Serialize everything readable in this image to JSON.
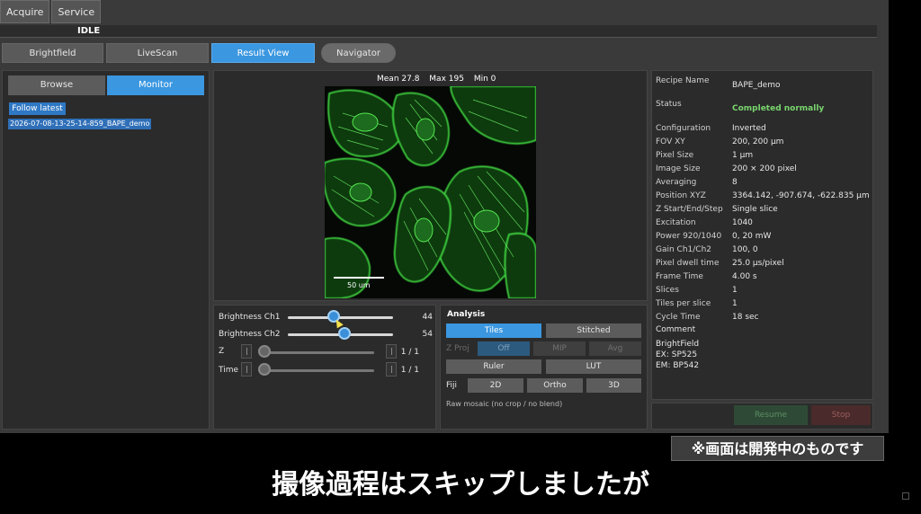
{
  "top_tabs": [
    "Acquire",
    "Service"
  ],
  "state_label": "IDLE",
  "mode_buttons": [
    "Brightfield",
    "LiveScan",
    "Result View",
    "Navigator"
  ],
  "left_panel": {
    "browse": "Browse",
    "monitor": "Monitor",
    "follow_latest": "Follow latest",
    "files": [
      "2026-07-08-13-25-14-859_BAPE_demo"
    ]
  },
  "image": {
    "mean": "Mean 27.8",
    "max": "Max 195",
    "min": "Min 0",
    "scale_label": "50 um"
  },
  "sliders": {
    "ch1": {
      "label": "Brightness Ch1",
      "value": "44",
      "fraction": 0.44
    },
    "ch2": {
      "label": "Brightness Ch2",
      "value": "54",
      "fraction": 0.54
    },
    "z": {
      "label": "Z",
      "value": "1 / 1"
    },
    "time": {
      "label": "Time",
      "value": "1 / 1"
    }
  },
  "analysis": {
    "title": "Analysis",
    "tiles": "Tiles",
    "stitched": "Stitched",
    "zproj_label": "Z Proj",
    "off": "Off",
    "mip": "MIP",
    "avg": "Avg",
    "ruler": "Ruler",
    "lut": "LUT",
    "fiji_label": "Fiji",
    "btn_2d": "2D",
    "ortho": "Ortho",
    "btn_3d": "3D",
    "note": "Raw mosaic (no crop / no blend)"
  },
  "info": {
    "recipe_name": {
      "key": "Recipe Name",
      "value": "BAPE_demo"
    },
    "status": {
      "key": "Status",
      "value": "Completed normally"
    },
    "rows": [
      {
        "key": "Configuration",
        "value": "Inverted"
      },
      {
        "key": "FOV XY",
        "value": "200, 200 μm"
      },
      {
        "key": "Pixel Size",
        "value": "1 μm"
      },
      {
        "key": "Image Size",
        "value": "200 × 200 pixel"
      },
      {
        "key": "Averaging",
        "value": "8"
      },
      {
        "key": "Position XYZ",
        "value": "3364.142, -907.674, -622.835 μm"
      },
      {
        "key": "Z Start/End/Step",
        "value": "Single slice"
      },
      {
        "key": "Excitation",
        "value": "1040"
      },
      {
        "key": "Power 920/1040",
        "value": "0, 20 mW"
      },
      {
        "key": "Gain Ch1/Ch2",
        "value": "100, 0"
      },
      {
        "key": "Pixel dwell time",
        "value": "25.0 μs/pixel"
      },
      {
        "key": "Frame Time",
        "value": "4.00 s"
      },
      {
        "key": "Slices",
        "value": "1"
      },
      {
        "key": "Tiles per slice",
        "value": "1"
      },
      {
        "key": "Cycle Time",
        "value": "18 sec"
      }
    ],
    "comment_label": "Comment",
    "comment_lines": [
      "BrightField",
      "EX: SP525",
      "EM: BP542"
    ]
  },
  "bottom": {
    "resume": "Resume",
    "stop": "Stop"
  },
  "notice": "※画面は開発中のものです",
  "subtitle": "撮像過程はスキップしましたが",
  "colors": {
    "accent": "#3b97e0",
    "ok": "#7ad66e",
    "fluor": "#39c23a"
  }
}
